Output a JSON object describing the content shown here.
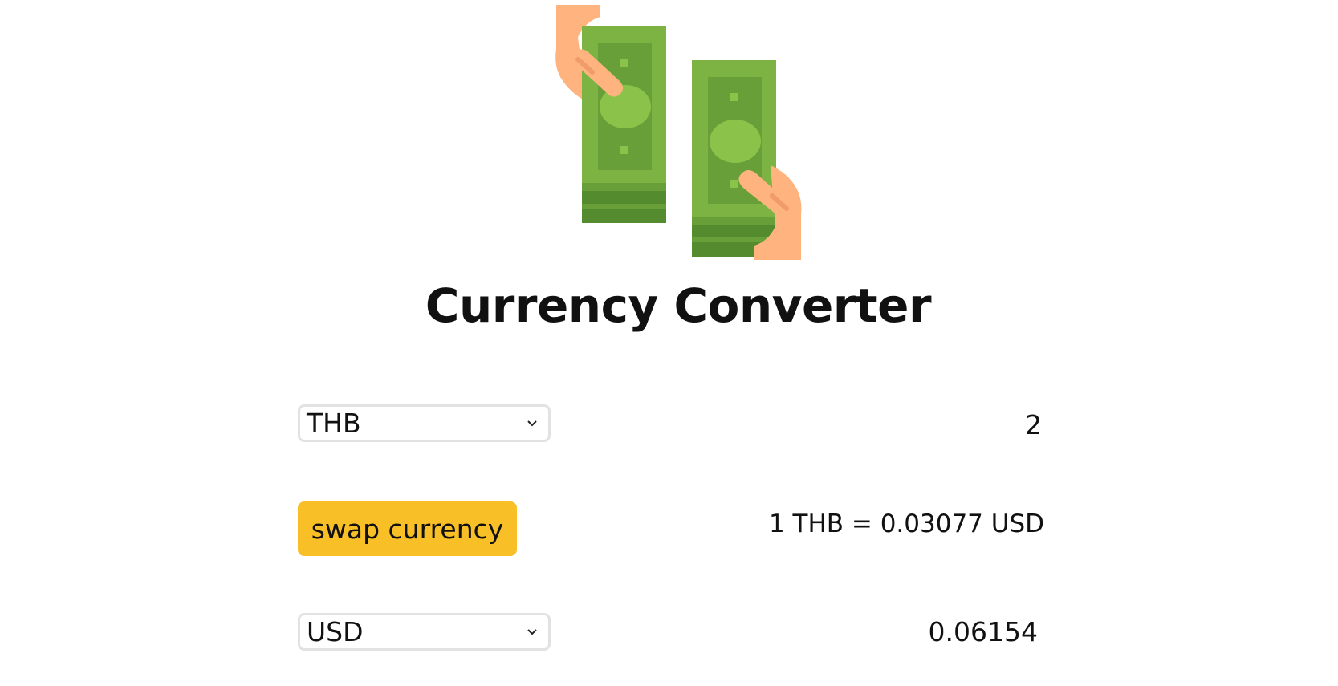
{
  "header": {
    "title": "Currency Converter",
    "logo_icon": "money-exchange-icon"
  },
  "converter": {
    "from": {
      "currency": "THB",
      "amount": "2"
    },
    "swap_label": "swap currency",
    "rate_text": "1 THB = 0.03077 USD",
    "to": {
      "currency": "USD",
      "amount": "0.06154"
    }
  },
  "colors": {
    "swap_button": "#f9bf26",
    "bill_green": "#7cb342",
    "bill_dark": "#689f38",
    "skin": "#ffb480"
  }
}
